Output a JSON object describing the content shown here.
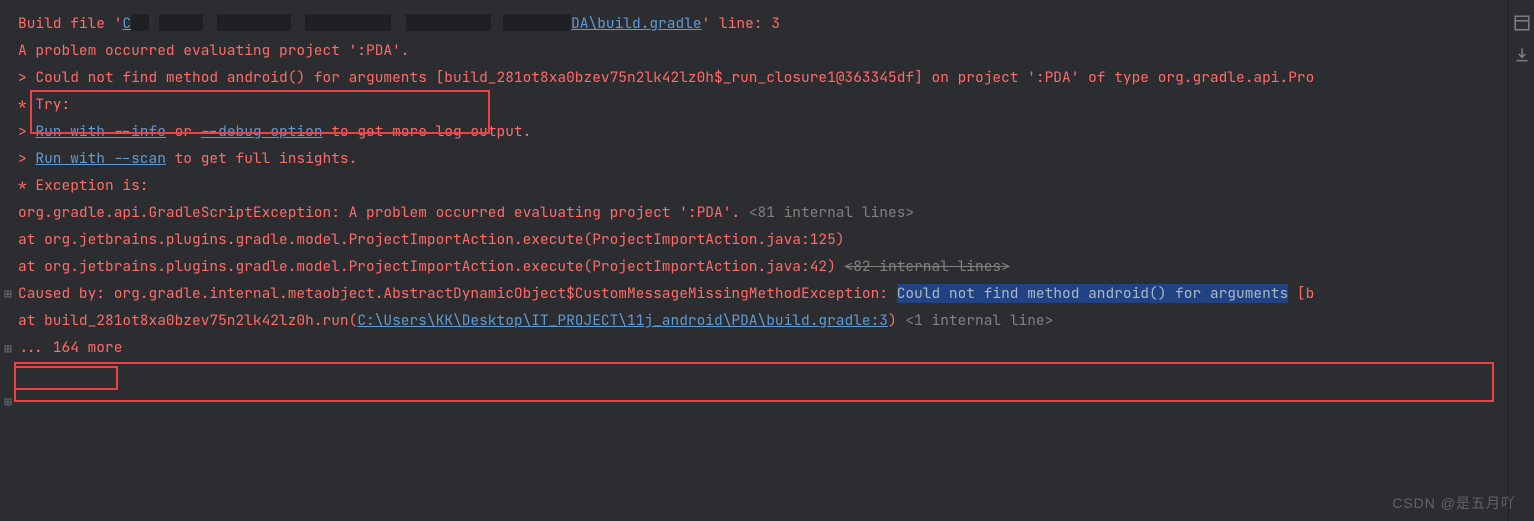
{
  "l1a": "Build file '",
  "l1b": "C",
  "l1c": "DA\\build.gradle",
  "l1d": "' line: 3",
  "l2": "A problem occurred evaluating project ':PDA'.",
  "l3a": "> ",
  "l3b": "Could not find method android() for arguments ",
  "l3c": "[build_281ot8xa0bzev75n2lk42lz0h$_run_closure1@363345df] on project ':PDA' of type org.gradle.api.Pro",
  "l4": "* Try:",
  "l5a": "> ",
  "l5b": "Run with --info",
  "l5c": " or ",
  "l5d": "--debug option",
  "l5e": " to get more log output.",
  "l6a": "> ",
  "l6b": "Run with --scan",
  "l6c": " to get full insights.",
  "l7": "* Exception is:",
  "l8a": "org.gradle.api.GradleScriptException: A problem occurred evaluating project ':PDA'. ",
  "l8b": "<81 internal lines>",
  "l9": "    at org.jetbrains.plugins.gradle.model.ProjectImportAction.execute(ProjectImportAction.java:125)",
  "l10a": "    at org.jetbrains.plugins.gradle.model.ProjectImportAction.execute(ProjectImportAction.java:42) ",
  "l10b": "<82 internal lines>",
  "l11a": "Caused by:",
  "l11b": " org.gradle.internal.metaobject.AbstractDynamicObject$CustomMessageMissingMethodException: ",
  "l11c": "Could not find method android() for arguments",
  "l11d": " [b",
  "l12a": "    at build_281ot8xa0bzev75n2lk42lz0h.run(",
  "l12b": "C:\\Users\\KK\\Desktop\\IT_PROJECT\\11j_android\\PDA\\build.gradle:3",
  "l12c": ") ",
  "l12d": "<1 internal line>",
  "l13": "    ... 164 more",
  "watermark": "CSDN @是五月吖",
  "fold": "⊞"
}
